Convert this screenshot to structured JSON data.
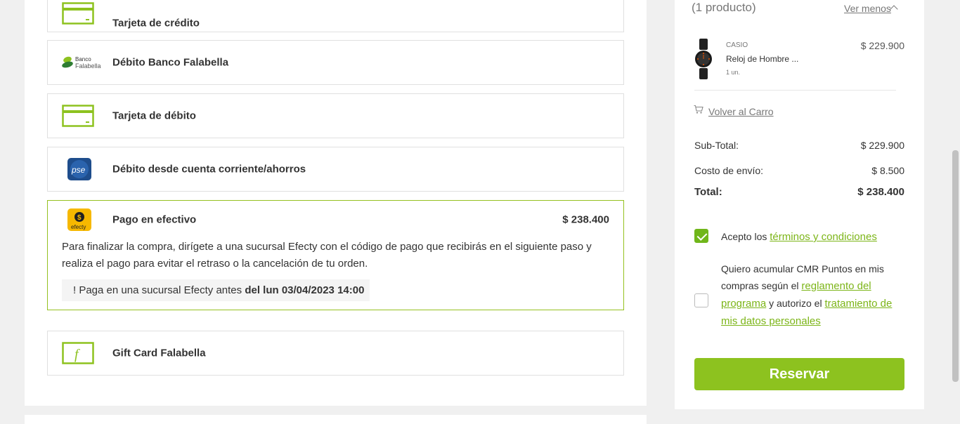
{
  "payment_methods": [
    {
      "label": "Tarjeta de crédito",
      "icon": "credit-card-icon"
    },
    {
      "label": "Débito Banco Falabella",
      "icon": "banco-falabella-logo",
      "logo_line1": "Banco",
      "logo_line2": "Falabella"
    },
    {
      "label": "Tarjeta de débito",
      "icon": "debit-card-icon"
    },
    {
      "label": "Débito desde cuenta corriente/ahorros",
      "icon": "pse-logo",
      "logo_text": "pse"
    },
    {
      "label": "Pago en efectivo",
      "icon": "efecty-logo",
      "logo_text": "efecty",
      "amount": "$ 238.400",
      "description": "Para finalizar la compra, dirígete a una sucursal Efecty con el código de pago que recibirás en el siguiente paso y realiza el pago para evitar el retraso o la cancelación de tu orden.",
      "notice_prefix": "! Paga en una sucursal Efecty antes ",
      "notice_bold": "del lun 03/04/2023 14:00"
    },
    {
      "label": "Gift Card Falabella",
      "icon": "gift-card-icon"
    }
  ],
  "summary": {
    "count": "(1 producto)",
    "toggle": "Ver menos",
    "product": {
      "brand": "CASIO",
      "name": "Reloj de Hombre ...",
      "qty": "1 un.",
      "price": "$ 229.900"
    },
    "back_to_cart": "Volver al Carro",
    "subtotal_label": "Sub-Total:",
    "subtotal": "$ 229.900",
    "shipping_label": "Costo de envío:",
    "shipping": "$ 8.500",
    "total_label": "Total:",
    "total": "$ 238.400",
    "terms_prefix": "Acepto los ",
    "terms_link": "términos y condiciones",
    "cmr_text1": "Quiero acumular CMR Puntos en mis compras según el ",
    "cmr_link1": "reglamento del programa",
    "cmr_text2": " y autorizo el ",
    "cmr_link2": "tratamiento de mis datos personales",
    "reserve_label": "Reservar"
  },
  "colors": {
    "accent": "#8dc21f",
    "link": "#7cb518",
    "selected_border": "#95c11f"
  }
}
